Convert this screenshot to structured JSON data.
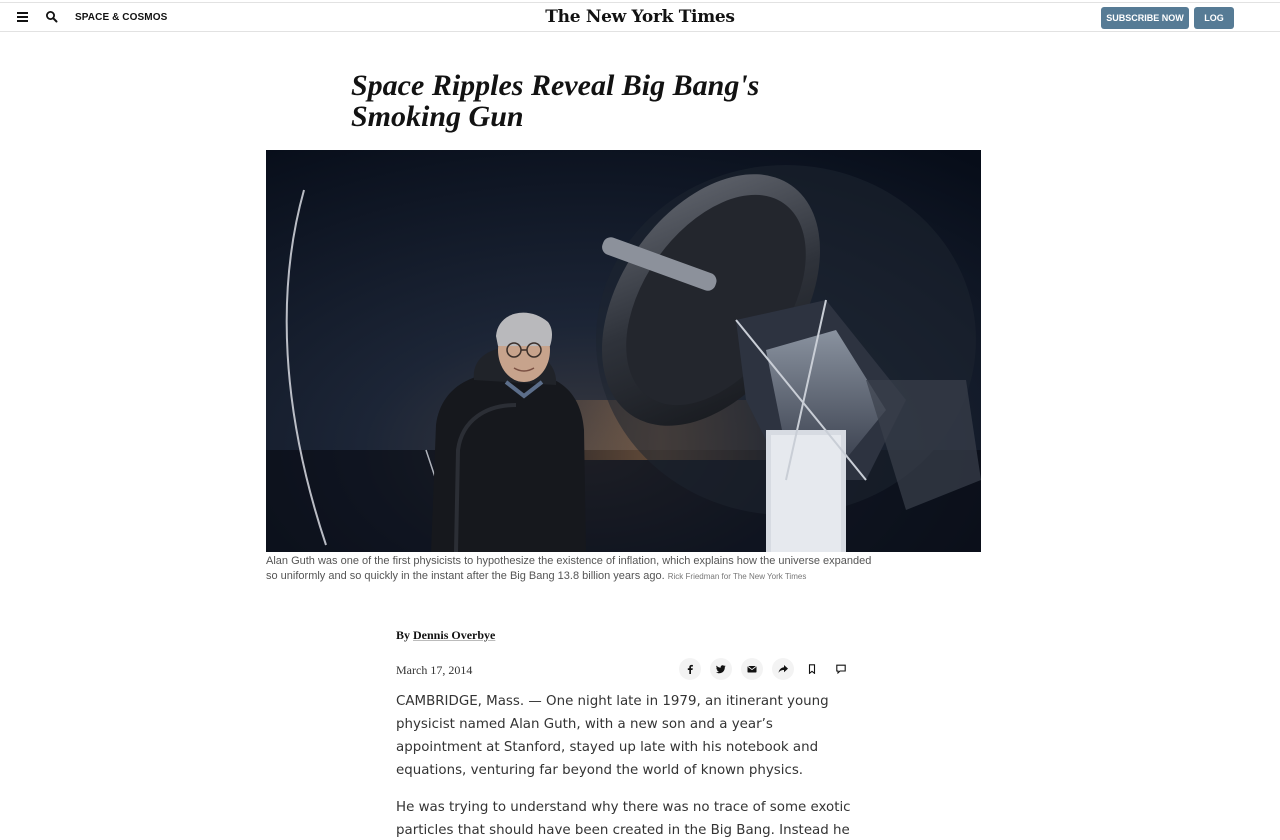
{
  "header": {
    "section_label": "SPACE & COSMOS",
    "logo_text": "The New York Times",
    "subscribe_label": "SUBSCRIBE NOW",
    "login_label": "LOG IN",
    "button_color": "#567b95"
  },
  "article": {
    "headline": "Space Ripples Reveal Big Bang's Smoking Gun",
    "caption_text": "Alan Guth was one of the first physicists to hypothesize the existence of inflation, which explains how the universe expanded so uniformly and so quickly in the instant after the Big Bang 13.8 billion years ago.",
    "caption_credit": "Rick Friedman for The New York Times",
    "byline_prefix": "By",
    "author": "Dennis Overbye",
    "date": "March 17, 2014",
    "share_icons": [
      "facebook-icon",
      "twitter-icon",
      "email-icon",
      "share-icon",
      "bookmark-icon",
      "comment-icon"
    ],
    "paragraphs": [
      "CAMBRIDGE, Mass. — One night late in 1979, an itinerant young physicist named Alan Guth, with a new son and a year’s appointment at Stanford, stayed up late with his notebook and equations, venturing far beyond the world of known physics.",
      "He was trying to understand why there was no trace of some exotic particles that should have been created in the Big Bang. Instead he"
    ]
  }
}
